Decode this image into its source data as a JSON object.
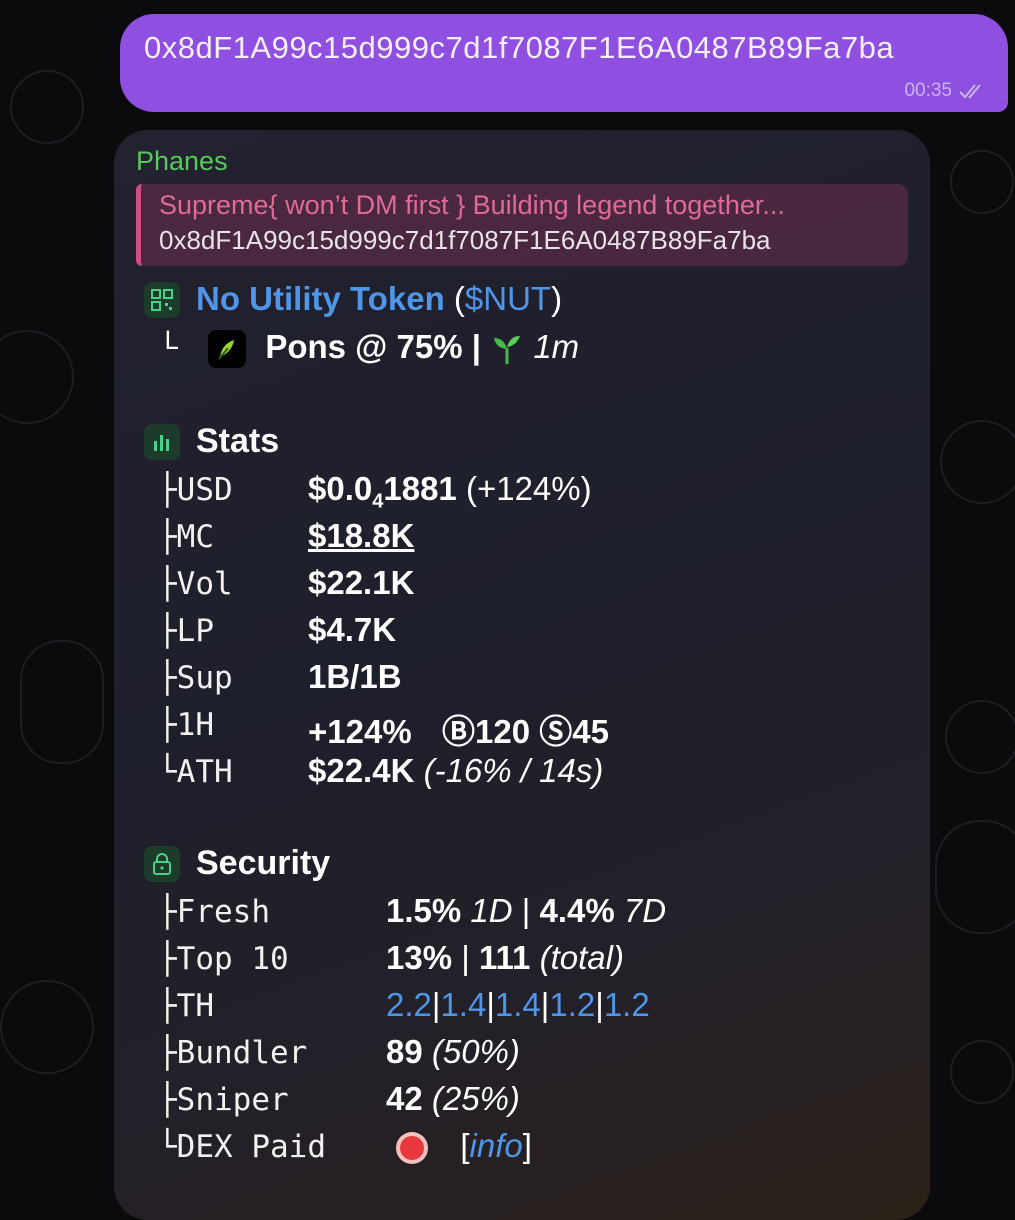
{
  "outgoing": {
    "text": "0x8dF1A99c15d999c7d1f7087F1E6A0487B89Fa7ba",
    "time": "00:35"
  },
  "incoming": {
    "sender": "Phanes",
    "reply": {
      "title": "Supreme{ won’t DM first } Building legend together...",
      "text": "0x8dF1A99c15d999c7d1f7087F1E6A0487B89Fa7ba"
    },
    "token": {
      "name": "No Utility Token",
      "ticker": "$NUT",
      "platform": "Pons @ 75%",
      "age": "1m",
      "branch": "└"
    },
    "stats": {
      "title": "Stats",
      "rows": [
        {
          "branch": "├",
          "label": "USD",
          "value_main": "$0.0",
          "value_sub": "4",
          "value_tail": "1881",
          "note": "(+124%)"
        },
        {
          "branch": "├",
          "label": "MC",
          "value": "$18.8K"
        },
        {
          "branch": "├",
          "label": "Vol",
          "value": "$22.1K"
        },
        {
          "branch": "├",
          "label": "LP",
          "value": "$4.7K"
        },
        {
          "branch": "├",
          "label": "Sup",
          "value": "1B/1B"
        },
        {
          "branch": "├",
          "label": "1H",
          "value": "+124%",
          "buys_icon": "Ⓑ",
          "buys": "120",
          "sells_icon": "Ⓢ",
          "sells": "45"
        },
        {
          "branch": "└",
          "label": "ATH",
          "value": "$22.4K",
          "note": "(-16% / 14s)"
        }
      ]
    },
    "security": {
      "title": "Security",
      "fresh": {
        "branch": "├",
        "label": "Fresh",
        "v1": "1.5%",
        "p1": "1D",
        "sep": "|",
        "v2": "4.4%",
        "p2": "7D"
      },
      "top10": {
        "branch": "├",
        "label": "Top 10",
        "v1": "13%",
        "sep": "|",
        "v2": "111",
        "note": "(total)"
      },
      "th": {
        "branch": "├",
        "label": "TH",
        "values": [
          "2.2",
          "1.4",
          "1.4",
          "1.2",
          "1.2"
        ],
        "sep": "|"
      },
      "bundler": {
        "branch": "├",
        "label": "Bundler",
        "value": "89",
        "note": "(50%)"
      },
      "sniper": {
        "branch": "├",
        "label": "Sniper",
        "value": "42",
        "note": "(25%)"
      },
      "dex": {
        "branch": "└",
        "label": "DEX Paid",
        "status_icon": "red-circle",
        "link_open": "[",
        "link": "info",
        "link_close": "]"
      }
    }
  },
  "colors": {
    "outgoing_bubble": "#8f4fe0",
    "sender": "#58c95a",
    "reply_title": "#e06a95",
    "link": "#4f95e8",
    "accent_icon": "#47d18a",
    "status_red": "#e8383d"
  }
}
